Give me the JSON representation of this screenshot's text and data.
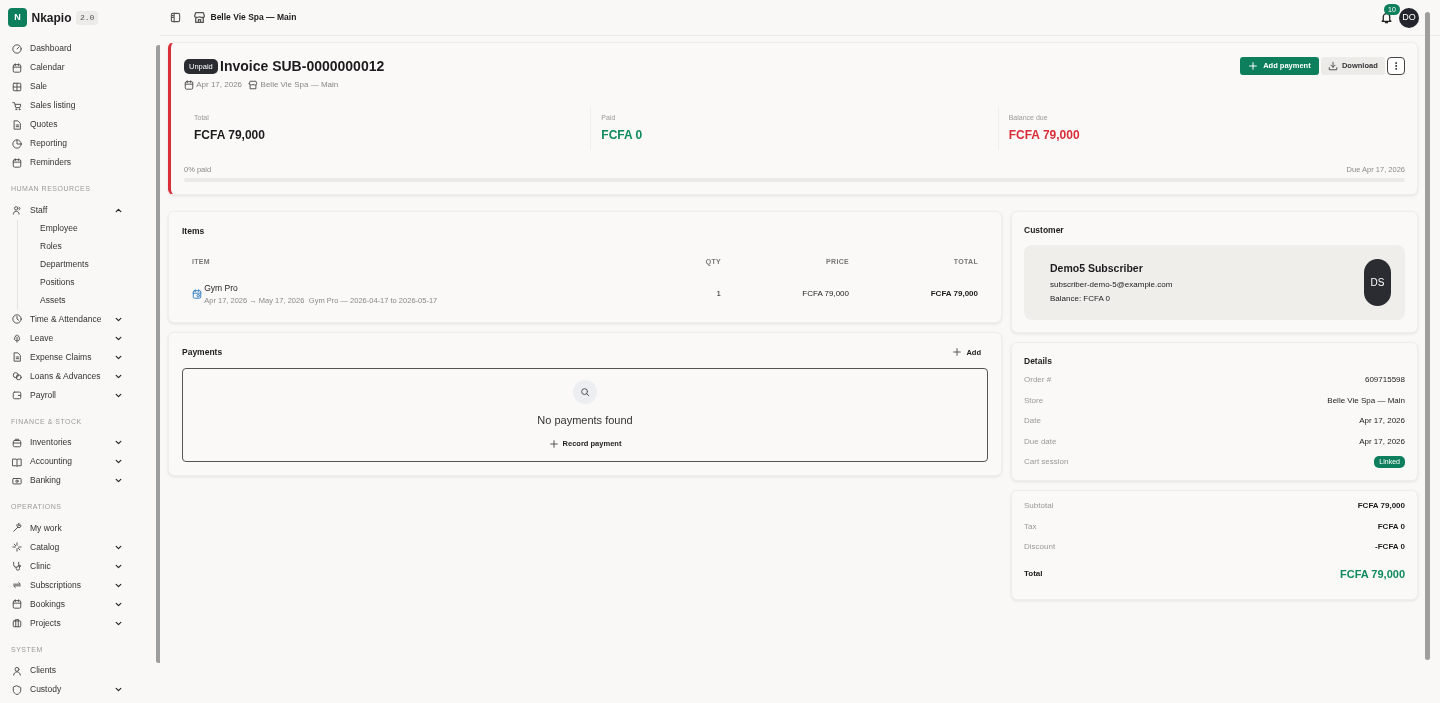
{
  "app": {
    "logo_letter": "N",
    "name": "Nkapio",
    "version": "2.0"
  },
  "sidebar": {
    "groups": [
      {
        "items": [
          {
            "label": "Dashboard",
            "expandable": false
          },
          {
            "label": "Calendar",
            "expandable": false
          },
          {
            "label": "Sale",
            "expandable": false
          },
          {
            "label": "Sales listing",
            "expandable": false
          },
          {
            "label": "Quotes",
            "expandable": false
          },
          {
            "label": "Reporting",
            "expandable": false
          },
          {
            "label": "Reminders",
            "expandable": false
          }
        ]
      },
      {
        "heading": "HUMAN RESOURCES",
        "items": [
          {
            "label": "Staff",
            "expandable": true,
            "expanded": true,
            "children": [
              {
                "label": "Employee"
              },
              {
                "label": "Roles"
              },
              {
                "label": "Departments"
              },
              {
                "label": "Positions"
              },
              {
                "label": "Assets"
              }
            ]
          },
          {
            "label": "Time & Attendance",
            "expandable": true,
            "expanded": false
          },
          {
            "label": "Leave",
            "expandable": true,
            "expanded": false
          },
          {
            "label": "Expense Claims",
            "expandable": true,
            "expanded": false
          },
          {
            "label": "Loans & Advances",
            "expandable": true,
            "expanded": false
          },
          {
            "label": "Payroll",
            "expandable": true,
            "expanded": false
          }
        ]
      },
      {
        "heading": "FINANCE & STOCK",
        "items": [
          {
            "label": "Inventories",
            "expandable": true,
            "expanded": false
          },
          {
            "label": "Accounting",
            "expandable": true,
            "expanded": false
          },
          {
            "label": "Banking",
            "expandable": true,
            "expanded": false
          }
        ]
      },
      {
        "heading": "OPERATIONS",
        "items": [
          {
            "label": "My work",
            "expandable": false
          },
          {
            "label": "Catalog",
            "expandable": true,
            "expanded": false
          },
          {
            "label": "Clinic",
            "expandable": true,
            "expanded": false
          },
          {
            "label": "Subscriptions",
            "expandable": true,
            "expanded": false
          },
          {
            "label": "Bookings",
            "expandable": true,
            "expanded": false
          },
          {
            "label": "Projects",
            "expandable": true,
            "expanded": false
          }
        ]
      },
      {
        "heading": "SYSTEM",
        "items": [
          {
            "label": "Clients",
            "expandable": false
          },
          {
            "label": "Custody",
            "expandable": true,
            "expanded": false
          }
        ]
      }
    ]
  },
  "topbar": {
    "store": "Belle Vie Spa — Main",
    "notifications": "10",
    "avatar": "DO"
  },
  "invoice": {
    "status": "Unpaid",
    "title": "Invoice SUB-0000000012",
    "date": "Apr 17, 2026",
    "store": "Belle Vie Spa — Main",
    "actions": [
      {
        "kind": "primary",
        "label": "Add payment"
      },
      {
        "kind": "secondary",
        "label": "Download"
      },
      {
        "kind": "more"
      }
    ],
    "summary": [
      {
        "label": "Total",
        "value": "FCFA 79,000",
        "color": "#1c1c1e"
      },
      {
        "label": "Paid",
        "value": "FCFA 0",
        "color": "#0e8a5f"
      },
      {
        "label": "Balance due",
        "value": "FCFA 79,000",
        "color": "#d92d3a"
      }
    ],
    "progress": {
      "label": "0% paid",
      "level": 0,
      "due": "Due Apr 17, 2026"
    }
  },
  "items": {
    "title": "Items",
    "columns": [
      "ITEM",
      "QTY",
      "PRICE",
      "TOTAL"
    ],
    "rows": [
      {
        "name": "Gym Pro",
        "period": "Apr 17, 2026 → May 17, 2026",
        "note": "Gym Pro — 2026-04-17 to 2026-05-17",
        "qty": "1",
        "price": "FCFA 79,000",
        "total": "FCFA 79,000"
      }
    ]
  },
  "payments": {
    "title": "Payments",
    "add": "Add",
    "empty": "No payments found",
    "record": "Record payment"
  },
  "customer": {
    "title": "Customer",
    "name": "Demo5 Subscriber",
    "email": "subscriber-demo-5@example.com",
    "balance": "Balance: FCFA 0",
    "initials": "DS"
  },
  "details": {
    "title": "Details",
    "rows": [
      {
        "kind": "text",
        "label": "Order #",
        "value": "609715598"
      },
      {
        "kind": "text",
        "label": "Store",
        "value": "Belle Vie Spa — Main"
      },
      {
        "kind": "text",
        "label": "Date",
        "value": "Apr 17, 2026"
      },
      {
        "kind": "text",
        "label": "Due date",
        "value": "Apr 17, 2026"
      },
      {
        "kind": "badge",
        "label": "Cart session",
        "value": "Linked"
      }
    ]
  },
  "totals": {
    "rows": [
      {
        "kind": "line",
        "label": "Subtotal",
        "value": "FCFA 79,000"
      },
      {
        "kind": "line",
        "label": "Tax",
        "value": "FCFA 0"
      },
      {
        "kind": "line",
        "label": "Discount",
        "value": "-FCFA 0"
      },
      {
        "kind": "grand",
        "label": "Total",
        "value": "FCFA 79,000"
      }
    ]
  }
}
